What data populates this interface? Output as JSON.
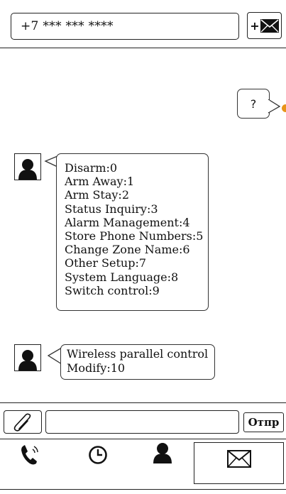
{
  "header": {
    "phone_number": "+7 *** *** ****",
    "new_message_plus": "+",
    "new_message_icon": "envelope-icon"
  },
  "conversation": {
    "outgoing": {
      "text": "?",
      "status_color": "#e8941a"
    },
    "incoming": [
      {
        "avatar_icon": "person-icon",
        "lines": [
          "Disarm:0",
          "Arm Away:1",
          "Arm Stay:2",
          "Status Inquiry:3",
          "Alarm Management:4",
          "Store Phone Numbers:5",
          "Change Zone Name:6",
          "Other Setup:7",
          "System Language:8",
          "Switch control:9"
        ]
      },
      {
        "avatar_icon": "person-icon",
        "lines": [
          "Wireless parallel control",
          "Modify:10"
        ]
      }
    ]
  },
  "composer": {
    "attach_icon": "paperclip-icon",
    "input_value": "",
    "send_label": "Отпр"
  },
  "nav": {
    "items": [
      {
        "icon": "phone-call-icon"
      },
      {
        "icon": "clock-icon"
      },
      {
        "icon": "person-icon"
      },
      {
        "icon": "envelope-icon",
        "selected": true
      }
    ]
  }
}
